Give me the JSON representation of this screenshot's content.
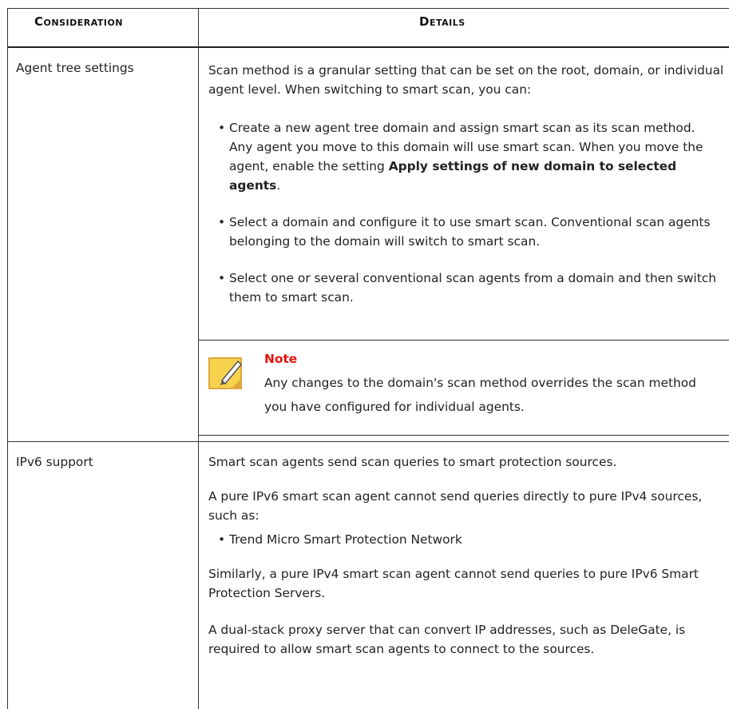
{
  "table": {
    "headers": {
      "consideration": "Consideration",
      "details": "Details"
    },
    "row1": {
      "consideration": "Agent tree settings",
      "intro": "Scan method is a granular setting that can be set on the root, domain, or individual agent level. When switching to smart scan, you can:",
      "bullet1": {
        "text_before": "Create a new agent tree domain and assign smart scan as its scan method. Any agent you move to this domain will use smart scan. When you move the agent, enable the setting ",
        "bold": "Apply settings of new domain to selected agents",
        "text_after": "."
      },
      "bullet2": "Select a domain and configure it to use smart scan. Conventional scan agents belonging to the domain will switch to smart scan.",
      "bullet3": "Select one or several conventional scan agents from a domain and then switch them to smart scan.",
      "note_title": "Note",
      "note_body": "Any changes to the domain's scan method overrides the scan method you have configured for individual agents."
    },
    "row2": {
      "consideration": "IPv6 support",
      "p1": "Smart scan agents send scan queries to smart protection sources.",
      "p2": "A pure IPv6 smart scan agent cannot send queries directly to pure IPv4 sources, such as:",
      "bullet1": "Trend Micro Smart Protection Network",
      "p3": "Similarly, a pure IPv4 smart scan agent cannot send queries to pure IPv6 Smart Protection Servers.",
      "p4": "A dual-stack proxy server that can convert IP addresses, such as DeleGate, is required to allow smart scan agents to connect to the sources."
    }
  },
  "icons": {
    "note": "note-pencil-icon"
  },
  "colors": {
    "note_title": "#e3120b",
    "note_icon_fill": "#f6d24d",
    "note_icon_border": "#e0a63a"
  }
}
